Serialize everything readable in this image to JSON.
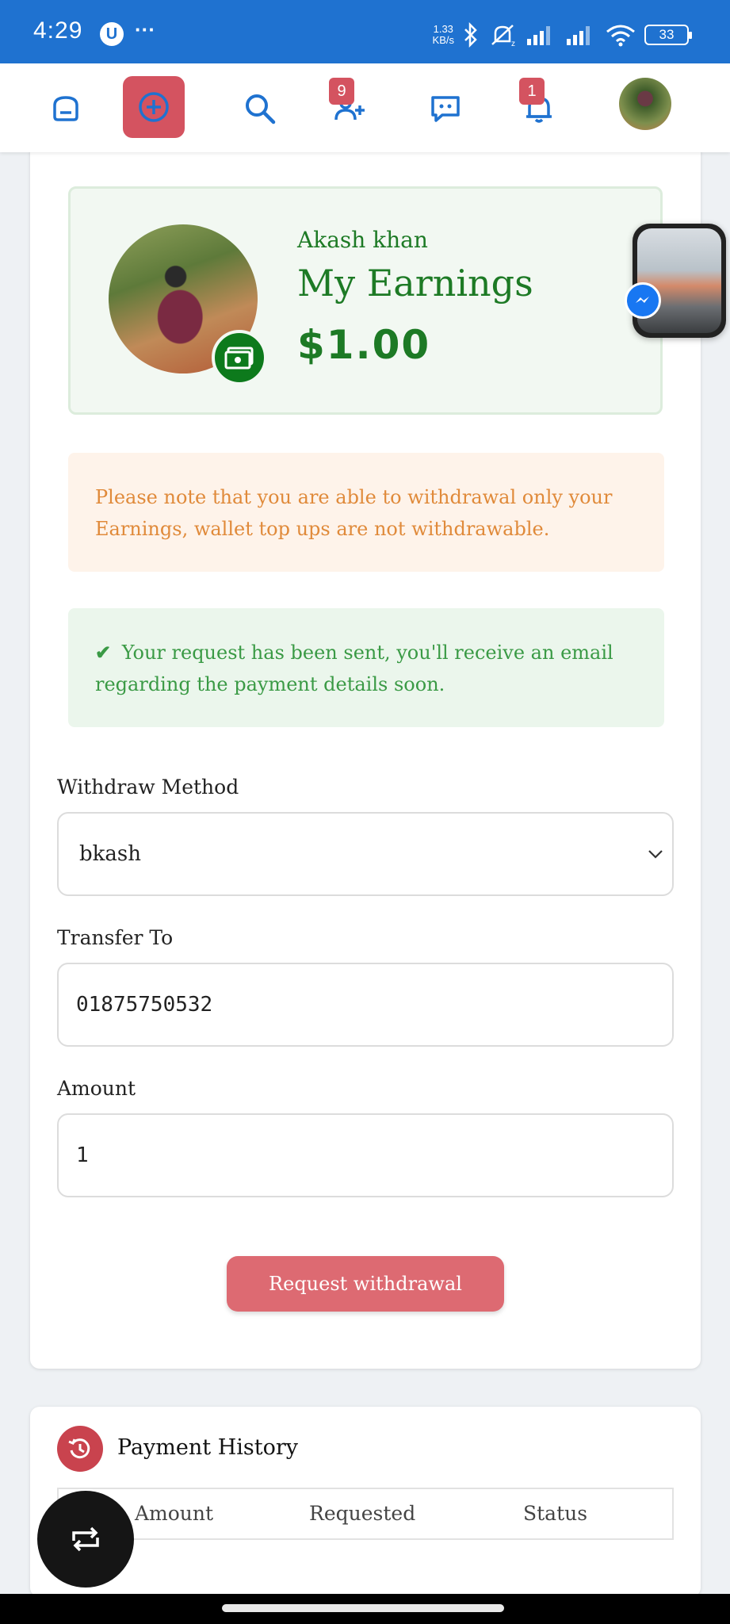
{
  "status_bar": {
    "time": "4:29",
    "notif_letter": "U",
    "more": "···",
    "speed_value": "1.33",
    "speed_unit": "KB/s",
    "battery": "33"
  },
  "appbar": {
    "icons": [
      "home-icon",
      "create-post-icon",
      "search-icon",
      "friend-requests-icon",
      "messages-icon",
      "notifications-icon"
    ],
    "friend_requests_badge": "9",
    "notifications_badge": "1",
    "accent_color": "#d45360",
    "icon_color": "#1f72d0"
  },
  "earnings": {
    "user_name": "Akash khan",
    "title": "My Earnings",
    "amount": "$1.00",
    "color": "#1d7a25"
  },
  "notice": {
    "text": "Please note that you are able to withdrawal only your Earnings, wallet top ups are not withdrawable."
  },
  "success": {
    "icon": "✔",
    "text": "Your request has been sent, you'll receive an email regarding the payment details soon."
  },
  "form": {
    "method_label": "Withdraw Method",
    "method_value": "bkash",
    "transfer_label": "Transfer To",
    "transfer_value": "01875750532",
    "amount_label": "Amount",
    "amount_value": "1",
    "submit_label": "Request withdrawal"
  },
  "history": {
    "title": "Payment History",
    "columns": [
      "#",
      "Amount",
      "Requested",
      "Status"
    ]
  }
}
